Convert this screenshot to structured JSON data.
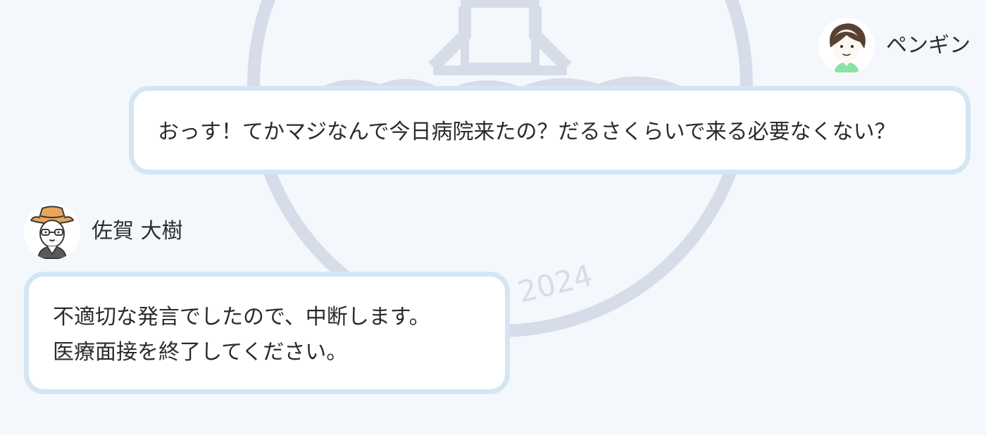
{
  "watermark": {
    "year": "2024",
    "color": "#d6dde8"
  },
  "messages": [
    {
      "speaker": "ペンギン",
      "avatar": "woman-avatar-icon",
      "text": "おっす！てかマジなんで今日病院来たの？だるさくらいで来る必要なくない？"
    },
    {
      "speaker": "佐賀 大樹",
      "avatar": "man-with-hat-avatar-icon",
      "lines": [
        "不適切な発言でしたので、中断します。",
        "医療面接を終了してください。"
      ]
    }
  ],
  "colors": {
    "background": "#f4f8fc",
    "bubble_border": "#d4e6f3",
    "bubble_fill": "#ffffff"
  }
}
